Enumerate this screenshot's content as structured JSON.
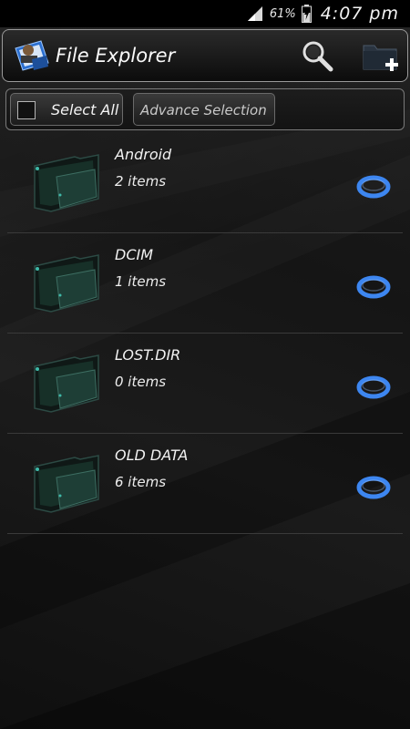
{
  "status_bar": {
    "battery_percent": "61%",
    "time": "4:07 pm"
  },
  "action_bar": {
    "title": "File Explorer",
    "icons": [
      "app-logo-icon",
      "search-icon",
      "new-folder-icon"
    ]
  },
  "selection_bar": {
    "select_all_label": "Select All",
    "select_all_checked": false,
    "advance_selection_label": "Advance Selection"
  },
  "files": [
    {
      "name": "Android",
      "count": "2 items",
      "icon": "folder-icon",
      "selected": false
    },
    {
      "name": "DCIM",
      "count": "1 items",
      "icon": "folder-icon",
      "selected": false
    },
    {
      "name": "LOST.DIR",
      "count": "0 items",
      "icon": "folder-icon",
      "selected": false
    },
    {
      "name": "OLD DATA",
      "count": "6 items",
      "icon": "folder-icon",
      "selected": false
    }
  ],
  "colors": {
    "accent_blue": "#3d86f0",
    "background": "#141414",
    "status_bar": "#000000"
  }
}
